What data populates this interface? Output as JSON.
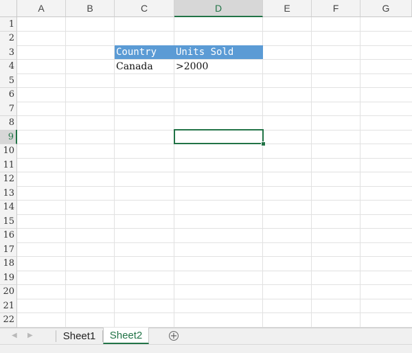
{
  "columns": [
    "A",
    "B",
    "C",
    "D",
    "E",
    "F",
    "G"
  ],
  "rows": [
    "1",
    "2",
    "3",
    "4",
    "5",
    "6",
    "7",
    "8",
    "9",
    "10",
    "11",
    "12",
    "13",
    "14",
    "15",
    "16",
    "17",
    "18",
    "19",
    "20",
    "21",
    "22"
  ],
  "selected_column": "D",
  "selected_row": "9",
  "cells": {
    "C3": "Country",
    "D3": "Units Sold",
    "C4": "Canada",
    "D4": ">2000"
  },
  "header_fill_color": "#5b9bd5",
  "accent_color": "#217346",
  "sheets": [
    "Sheet1",
    "Sheet2"
  ],
  "active_sheet": "Sheet2",
  "icons": {
    "prev": "chevron-left-icon",
    "next": "chevron-right-icon",
    "add": "plus-circle-icon"
  }
}
